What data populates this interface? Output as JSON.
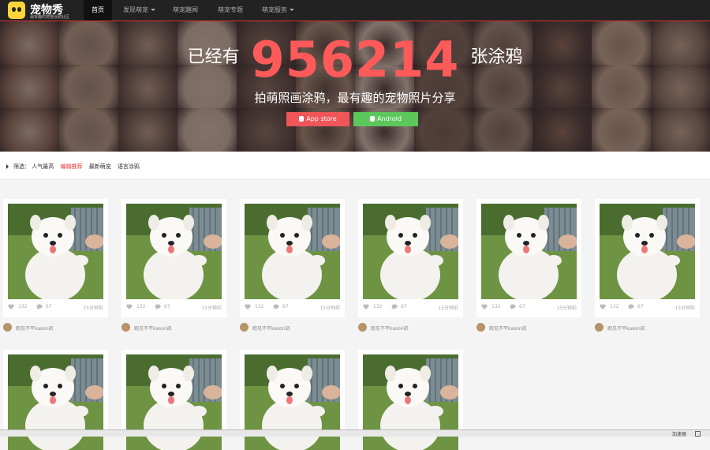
{
  "app": {
    "name": "宠物秀",
    "tagline": "最有趣的宠物涂鸦社区"
  },
  "nav": [
    {
      "label": "首页",
      "active": true,
      "dropdown": false
    },
    {
      "label": "发现萌宠",
      "active": false,
      "dropdown": true
    },
    {
      "label": "萌宠趣闻",
      "active": false,
      "dropdown": false
    },
    {
      "label": "萌宠专题",
      "active": false,
      "dropdown": false
    },
    {
      "label": "萌宠服务",
      "active": false,
      "dropdown": true
    }
  ],
  "hero": {
    "count_prefix": "已经有",
    "count": "956214",
    "count_suffix": "张涂鸦",
    "slogan": "拍萌照画涂鸦，最有趣的宠物照片分享",
    "appstore_label": "App store",
    "android_label": "Android"
  },
  "filter": {
    "label": "筛选：",
    "options": [
      {
        "label": "人气最高",
        "active": false
      },
      {
        "label": "编辑推荐",
        "active": true
      },
      {
        "label": "最新萌宠",
        "active": false
      },
      {
        "label": "语言涂鸦",
        "active": false
      }
    ]
  },
  "cards": [
    {
      "likes": "132",
      "comments": "67",
      "time": "15分钟前",
      "author": "跑见不平kason凯"
    },
    {
      "likes": "132",
      "comments": "67",
      "time": "15分钟前",
      "author": "跑见不平kason凯"
    },
    {
      "likes": "132",
      "comments": "67",
      "time": "15分钟前",
      "author": "跑见不平kason凯"
    },
    {
      "likes": "132",
      "comments": "67",
      "time": "15分钟前",
      "author": "跑见不平kason凯"
    },
    {
      "likes": "132",
      "comments": "67",
      "time": "15分钟前",
      "author": "跑见不平kason凯"
    },
    {
      "likes": "132",
      "comments": "67",
      "time": "15分钟前",
      "author": "跑见不平kason凯"
    },
    {
      "likes": "",
      "comments": "",
      "time": "",
      "author": ""
    },
    {
      "likes": "",
      "comments": "",
      "time": "",
      "author": ""
    },
    {
      "likes": "",
      "comments": "",
      "time": "",
      "author": ""
    },
    {
      "likes": "",
      "comments": "",
      "time": "",
      "author": ""
    }
  ],
  "statusbar": {
    "text": "加速器"
  },
  "colors": {
    "accent": "#ff5a5a",
    "appstore": "#f05557",
    "android": "#5cc85c",
    "nav_bg": "#222222"
  }
}
